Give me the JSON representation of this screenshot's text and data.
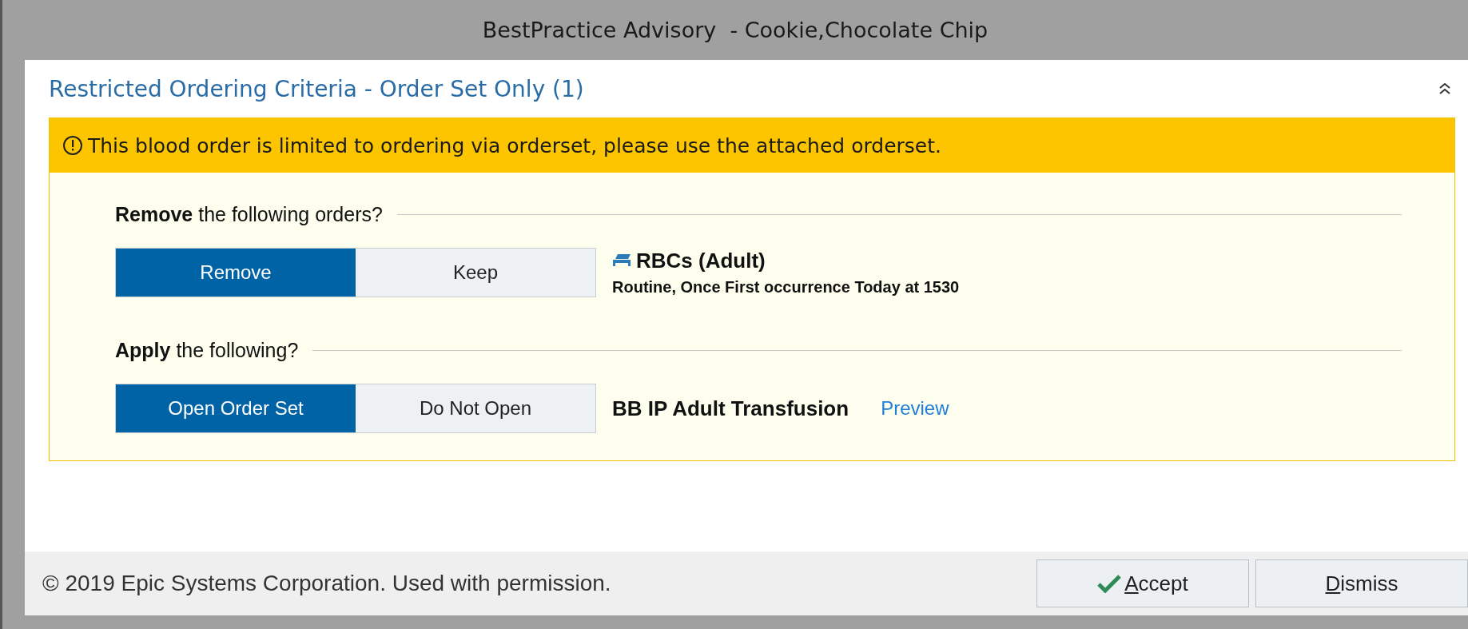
{
  "window": {
    "title": "BestPractice Advisory  - Cookie,Chocolate Chip"
  },
  "advisory": {
    "title": "Restricted Ordering Criteria - Order Set Only (1)",
    "collapsed": false,
    "banner": "This blood order is limited to ordering via orderset, please use the attached orderset.",
    "sections": [
      {
        "kind": "order",
        "question": "**Remove** the following orders?",
        "options": [
          {
            "label": "Remove",
            "selected": true
          },
          {
            "label": "Keep",
            "selected": false
          }
        ],
        "name": "RBCs (Adult)",
        "detail": "Routine, Once First occurrence Today at 1530"
      },
      {
        "kind": "orderset",
        "question": "**Apply** the following?",
        "options": [
          {
            "label": "Open Order Set",
            "selected": true
          },
          {
            "label": "Do Not Open",
            "selected": false
          }
        ],
        "name": "BB IP Adult Transfusion",
        "link": "Preview"
      }
    ]
  },
  "footer": {
    "copyright": "© 2019 Epic Systems Corporation. Used with permission.",
    "buttons": [
      {
        "kind": "accept",
        "label_parts": [
          {
            "text": "A",
            "underlined": true
          },
          {
            "text": "ccept",
            "underlined": false
          }
        ]
      },
      {
        "kind": "dismiss",
        "label_parts": [
          {
            "text": "D",
            "underlined": true
          },
          {
            "text": "ismiss",
            "underlined": false
          }
        ]
      }
    ]
  }
}
